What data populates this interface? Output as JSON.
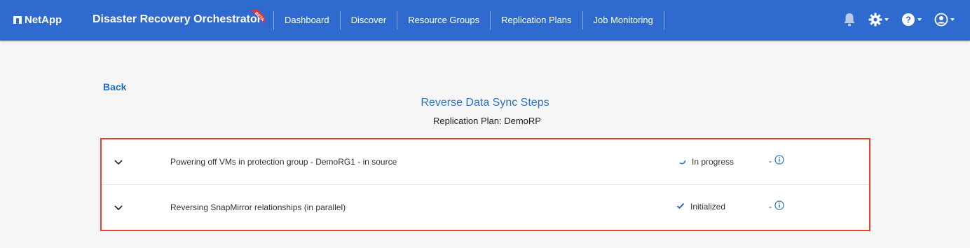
{
  "header": {
    "brand": "NetApp",
    "app_title": "Disaster Recovery Orchestrator",
    "badge": "BETA",
    "nav": [
      {
        "label": "Dashboard"
      },
      {
        "label": "Discover"
      },
      {
        "label": "Resource Groups"
      },
      {
        "label": "Replication Plans"
      },
      {
        "label": "Job Monitoring"
      }
    ],
    "icons": [
      "bell-icon",
      "gear-icon",
      "help-icon",
      "user-icon"
    ],
    "bar_color": "#2f6bcf"
  },
  "main": {
    "back_label": "Back",
    "title": "Reverse Data Sync Steps",
    "subtitle": "Replication Plan: DemoRP",
    "steps": [
      {
        "label": "Powering off VMs in protection group - DemoRG1 - in source",
        "status": "In progress",
        "status_icon": "spinner-icon",
        "extra": "-"
      },
      {
        "label": "Reversing SnapMirror relationships (in parallel)",
        "status": "Initialized",
        "status_icon": "check-icon",
        "extra": "-"
      }
    ],
    "highlight_color": "#e8412c"
  }
}
